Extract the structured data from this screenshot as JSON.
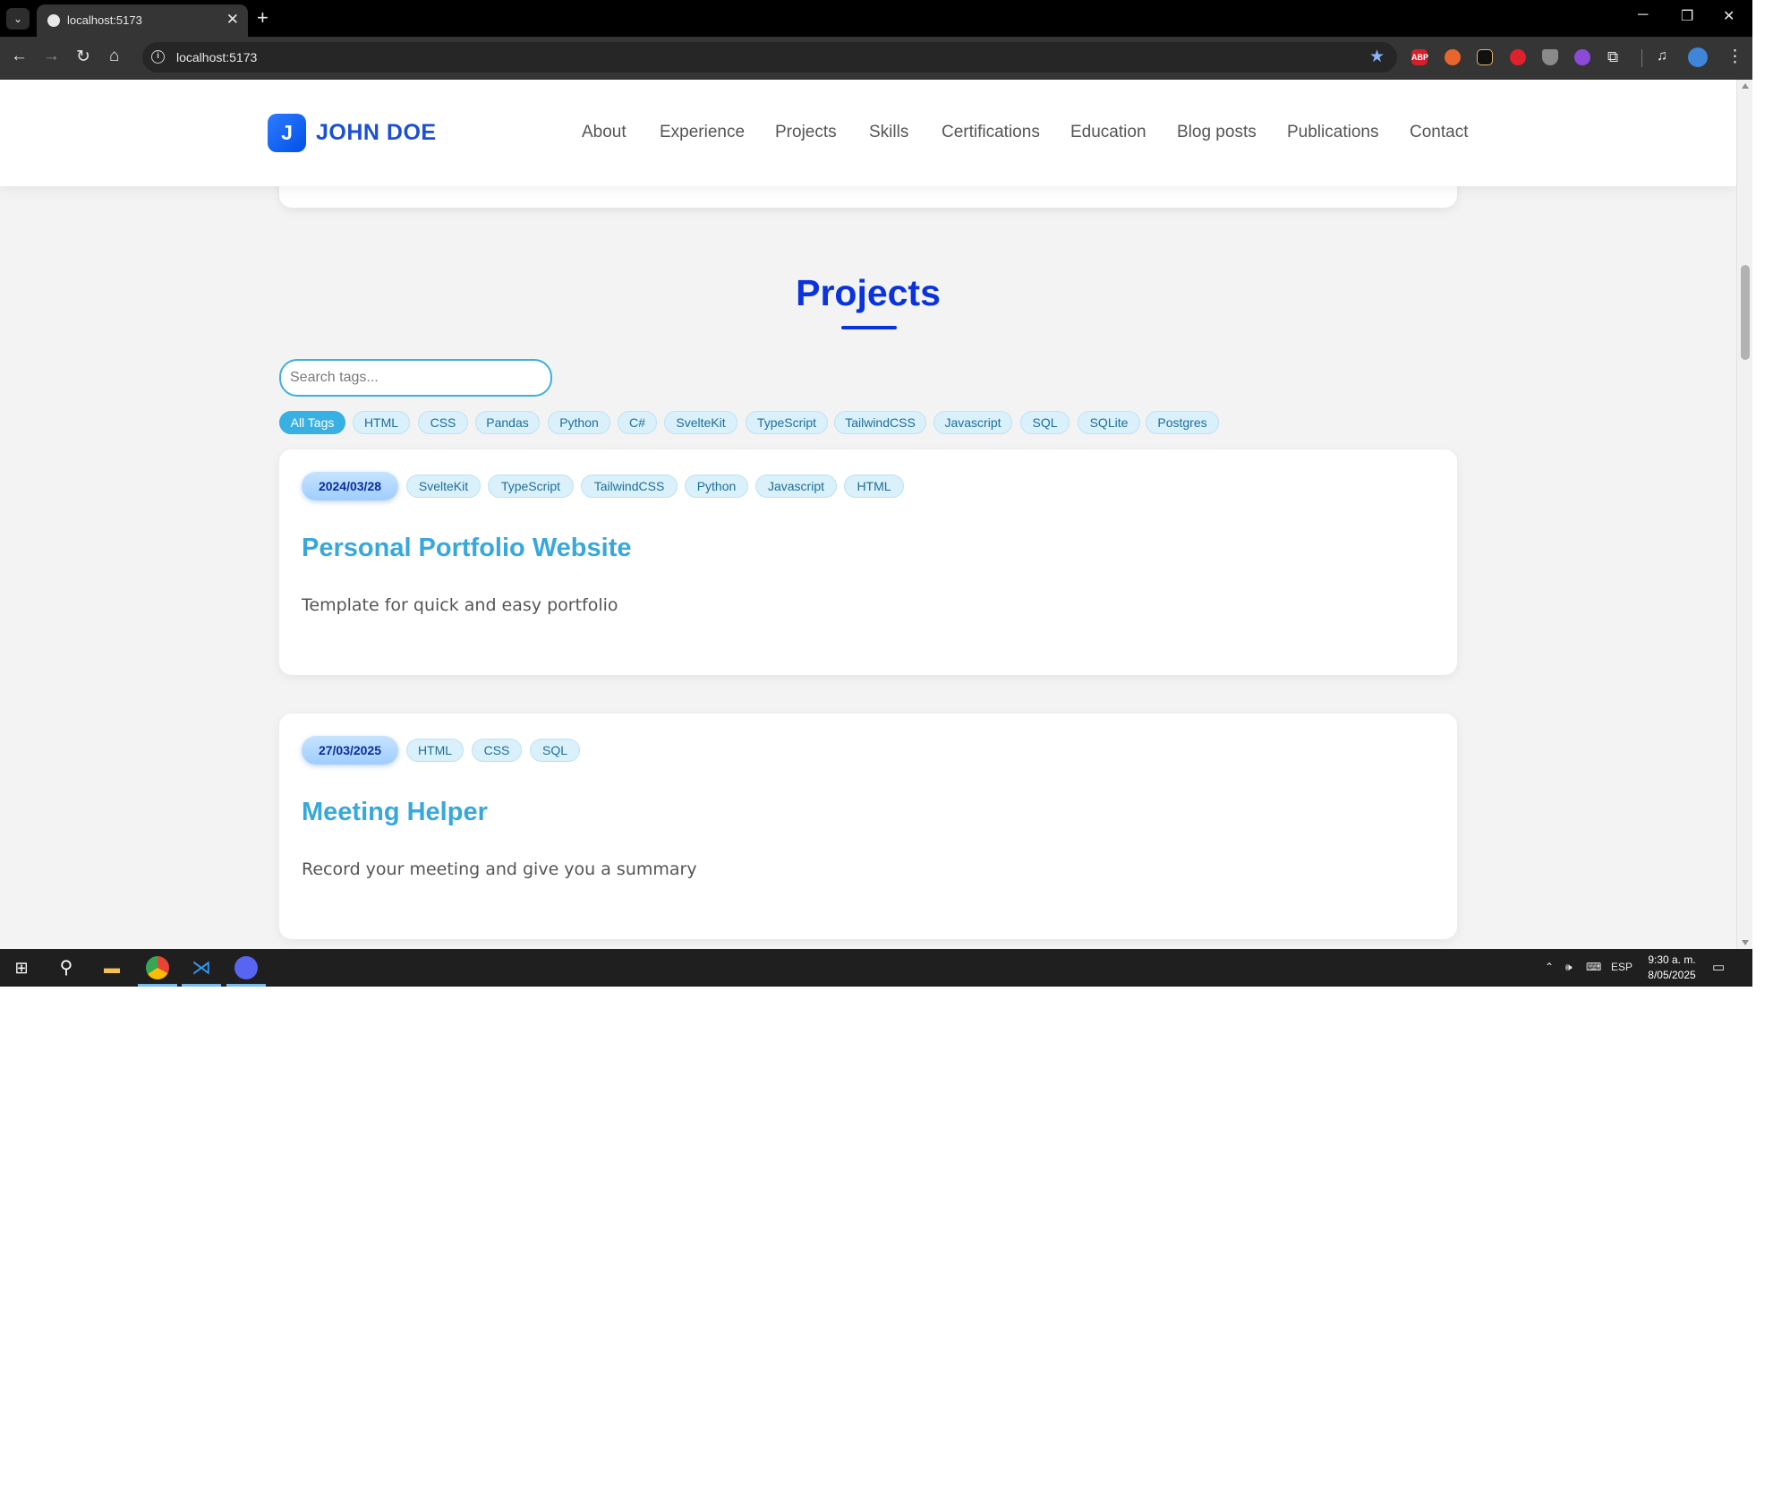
{
  "browser": {
    "tab_title": "localhost:5173",
    "url": "localhost:5173",
    "extensions": [
      "ABP",
      "ublock-icon",
      "shield-icon",
      "puzzle-icon"
    ]
  },
  "site": {
    "logo_letter": "J",
    "logo_text": "JOHN DOE",
    "nav": [
      "About",
      "Experience",
      "Projects",
      "Skills",
      "Certifications",
      "Education",
      "Blog posts",
      "Publications",
      "Contact"
    ]
  },
  "projects": {
    "title": "Projects",
    "search_placeholder": "Search tags...",
    "tags": [
      "All Tags",
      "HTML",
      "CSS",
      "Pandas",
      "Python",
      "C#",
      "SvelteKit",
      "TypeScript",
      "TailwindCSS",
      "Javascript",
      "SQL",
      "SQLite",
      "Postgres"
    ],
    "active_tag": "All Tags",
    "items": [
      {
        "date": "2024/03/28",
        "tags": [
          "SvelteKit",
          "TypeScript",
          "TailwindCSS",
          "Python",
          "Javascript",
          "HTML"
        ],
        "title": "Personal Portfolio Website",
        "description": "Template for quick and easy portfolio"
      },
      {
        "date": "27/03/2025",
        "tags": [
          "HTML",
          "CSS",
          "SQL"
        ],
        "title": "Meeting Helper",
        "description": "Record your meeting and give you a summary"
      }
    ]
  },
  "taskbar": {
    "language": "ESP",
    "time": "9:30 a. m.",
    "date": "8/05/2025",
    "pinned": [
      "windows-start-icon",
      "search-icon",
      "file-explorer-icon",
      "chrome-icon",
      "vscode-icon",
      "discord-icon"
    ]
  },
  "colors": {
    "accent": "#0a33dd",
    "tag_bg": "#daf0fb",
    "tag_active": "#38b0e3",
    "card_title": "#36a8dc"
  }
}
